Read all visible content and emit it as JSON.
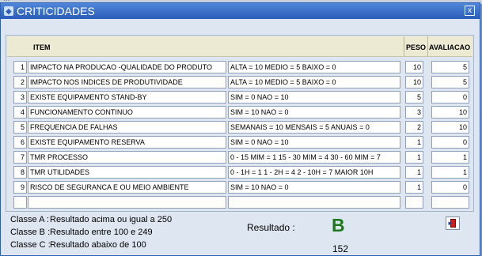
{
  "window": {
    "title": "CRITICIDADES",
    "close_label": "x"
  },
  "background_text": "...",
  "grid": {
    "headers": {
      "item": "ITEM",
      "peso": "PESO",
      "avaliacao": "AVALIACAO"
    },
    "rows": [
      {
        "num": "1",
        "item": "IMPACTO NA PRODUCAO -QUALIDADE DO PRODUTO",
        "criteria": "ALTA = 10  MEDIO = 5  BAIXO = 0",
        "peso": "10",
        "avaliacao": "5"
      },
      {
        "num": "2",
        "item": "IMPACTO NOS INDICES DE PRODUTIVIDADE",
        "criteria": "ALTA = 10  MEDIO = 5  BAIXO = 0",
        "peso": "10",
        "avaliacao": "5"
      },
      {
        "num": "3",
        "item": "EXISTE EQUIPAMENTO STAND-BY",
        "criteria": "SIM = 0  NAO = 10",
        "peso": "5",
        "avaliacao": "0"
      },
      {
        "num": "4",
        "item": "FUNCIONAMENTO CONTINUO",
        "criteria": "SIM = 10 NAO = 0",
        "peso": "3",
        "avaliacao": "10"
      },
      {
        "num": "5",
        "item": "FREQUENCIA DE FALHAS",
        "criteria": "SEMANAIS = 10  MENSAIS = 5  ANUAIS = 0",
        "peso": "2",
        "avaliacao": "10"
      },
      {
        "num": "6",
        "item": "EXISTE EQUIPAMENTO RESERVA",
        "criteria": "SIM = 0  NAO = 10",
        "peso": "1",
        "avaliacao": "0"
      },
      {
        "num": "7",
        "item": "TMR PROCESSO",
        "criteria": "0 - 15 MIM = 1   15 - 30 MIM = 4   30 - 60 MIM = 7",
        "peso": "1",
        "avaliacao": "1"
      },
      {
        "num": "8",
        "item": "TMR UTILIDADES",
        "criteria": "0 - 1H = 1   1 - 2H = 4    2 - 10H = 7  MAIOR 10H",
        "peso": "1",
        "avaliacao": "1"
      },
      {
        "num": "9",
        "item": "RISCO DE SEGURANCA E OU MEIO AMBIENTE",
        "criteria": "SIM = 10  NAO = 0",
        "peso": "1",
        "avaliacao": "0"
      },
      {
        "num": "",
        "item": "",
        "criteria": "",
        "peso": "",
        "avaliacao": ""
      }
    ]
  },
  "legend": [
    {
      "key": "Classe A :",
      "text": "Resultado acima ou igual a 250"
    },
    {
      "key": "Classe B :",
      "text": "Resultado entre 100 e 249"
    },
    {
      "key": "Classe C :",
      "text": "Resultado abaixo de 100"
    }
  ],
  "result": {
    "label": "Resultado :",
    "grade": "B",
    "score": "152",
    "grade_color": "#1c7a1c"
  },
  "colors": {
    "titlebar": "#3a6fc8",
    "window_bg": "#dde6f1",
    "header_bg": "#ecead2"
  },
  "icons": {
    "app": "app-icon",
    "close": "close-icon",
    "exit": "exit-door-icon"
  }
}
